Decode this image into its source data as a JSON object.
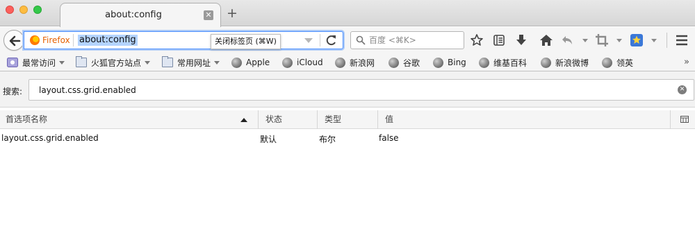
{
  "window": {
    "tab_title": "about:config",
    "new_tab_symbol": "+"
  },
  "navbar": {
    "identity_label": "Firefox",
    "url": "about:config",
    "tooltip": "关闭标签页 (⌘W)",
    "search_placeholder": "百度 <⌘K>"
  },
  "bookmarks": [
    {
      "label": "最常访问",
      "icon": "most-visited-icon",
      "menu": true
    },
    {
      "label": "火狐官方站点",
      "icon": "folder-icon",
      "menu": true
    },
    {
      "label": "常用网址",
      "icon": "folder-icon",
      "menu": true
    },
    {
      "label": "Apple",
      "icon": "globe-icon",
      "menu": false
    },
    {
      "label": "iCloud",
      "icon": "globe-icon",
      "menu": false
    },
    {
      "label": "新浪网",
      "icon": "globe-icon",
      "menu": false
    },
    {
      "label": "谷歌",
      "icon": "globe-icon",
      "menu": false
    },
    {
      "label": "Bing",
      "icon": "globe-icon",
      "menu": false
    },
    {
      "label": "维基百科",
      "icon": "globe-icon",
      "menu": false
    },
    {
      "label": "新浪微博",
      "icon": "globe-icon",
      "menu": false
    },
    {
      "label": "领英",
      "icon": "globe-icon",
      "menu": false
    }
  ],
  "config": {
    "search_label": "搜索:",
    "search_value": "layout.css.grid.enabled",
    "columns": {
      "name": "首选项名称",
      "status": "状态",
      "type": "类型",
      "value": "值"
    },
    "rows": [
      {
        "name": "layout.css.grid.enabled",
        "status": "默认",
        "type": "布尔",
        "value": "false"
      }
    ]
  },
  "colors": {
    "accent": "#4d90fe",
    "firefox_orange": "#e66000",
    "url_selection": "#b4d4ff"
  }
}
